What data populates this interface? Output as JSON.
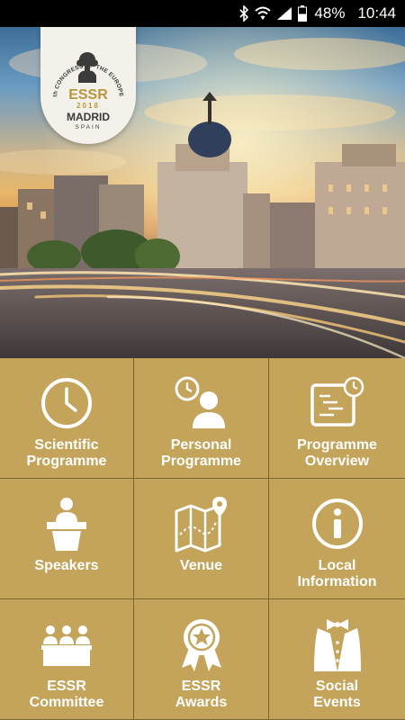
{
  "status_bar": {
    "battery": "48%",
    "time": "10:44"
  },
  "logo": {
    "ring_text": "th CONGRESS OF THE EUROPEAN SOCIETY FOR SURGICAL RESEARCH",
    "acronym": "ESSR",
    "year": "2018",
    "city": "MADRID",
    "country": "SPAIN"
  },
  "menu": [
    {
      "line1": "Scientific",
      "line2": "Programme",
      "icon": "clock-icon"
    },
    {
      "line1": "Personal",
      "line2": "Programme",
      "icon": "person-clock-icon"
    },
    {
      "line1": "Programme",
      "line2": "Overview",
      "icon": "schedule-board-icon"
    },
    {
      "line1": "Speakers",
      "line2": "",
      "icon": "podium-speaker-icon"
    },
    {
      "line1": "Venue",
      "line2": "",
      "icon": "map-pin-icon"
    },
    {
      "line1": "Local",
      "line2": "Information",
      "icon": "info-icon"
    },
    {
      "line1": "ESSR",
      "line2": "Committee",
      "icon": "committee-icon"
    },
    {
      "line1": "ESSR",
      "line2": "Awards",
      "icon": "award-ribbon-icon"
    },
    {
      "line1": "Social",
      "line2": "Events",
      "icon": "bowtie-tuxedo-icon"
    }
  ],
  "colors": {
    "tile_background": "#c3a45a",
    "tile_divider": "#7a6432",
    "text": "#ffffff"
  }
}
